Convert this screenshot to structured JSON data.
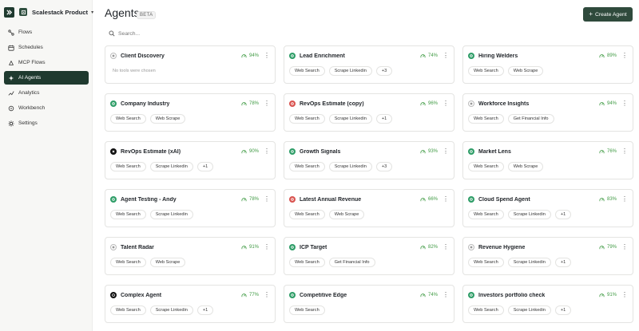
{
  "workspace": {
    "name": "Scalestack Product"
  },
  "nav": [
    {
      "label": "Flows",
      "icon": "flows-icon"
    },
    {
      "label": "Schedules",
      "icon": "calendar-icon"
    },
    {
      "label": "MCP Flows",
      "icon": "mcp-icon"
    },
    {
      "label": "AI Agents",
      "icon": "sparkle-icon",
      "active": true
    },
    {
      "label": "Analytics",
      "icon": "chart-icon"
    },
    {
      "label": "Workbench",
      "icon": "workbench-icon"
    },
    {
      "label": "Settings",
      "icon": "gear-icon"
    }
  ],
  "header": {
    "title": "Agents",
    "badge": "BETA",
    "create_label": "Create Agent"
  },
  "search": {
    "placeholder": "Search..."
  },
  "colors": {
    "brand": "#1f3a2f",
    "score_green": "#3f9a43",
    "icon_green": "#2e9d67",
    "icon_red": "#d9534f"
  },
  "no_tools_text": "No tools were chosen",
  "agents": [
    {
      "name": "Client Discovery",
      "icon": "plus-circle-icon",
      "score": "94%",
      "tools": []
    },
    {
      "name": "Lead Enrichment",
      "icon": "green-circle-icon",
      "score": "74%",
      "tools": [
        "Web Search",
        "Scrape Linkedin",
        "+3"
      ]
    },
    {
      "name": "Hiring Welders",
      "icon": "green-circle-icon",
      "score": "89%",
      "tools": [
        "Web Search",
        "Web Scrape"
      ]
    },
    {
      "name": "Company Industry",
      "icon": "green-circle-icon",
      "score": "78%",
      "tools": [
        "Web Search",
        "Web Scrape"
      ]
    },
    {
      "name": "RevOps Estimate (copy)",
      "icon": "red-circle-icon",
      "score": "96%",
      "tools": [
        "Web Search",
        "Scrape Linkedin",
        "+1"
      ]
    },
    {
      "name": "Workforce Insights",
      "icon": "plus-circle-icon",
      "score": "94%",
      "tools": [
        "Web Search",
        "Get Financial Info"
      ]
    },
    {
      "name": "RevOps Estimate (xAI)",
      "icon": "xai-icon",
      "score": "90%",
      "tools": [
        "Web Search",
        "Scrape Linkedin",
        "+1"
      ]
    },
    {
      "name": "Growth Signals",
      "icon": "green-circle-icon",
      "score": "93%",
      "tools": [
        "Web Search",
        "Scrape Linkedin",
        "+3"
      ]
    },
    {
      "name": "Market Lens",
      "icon": "green-circle-icon",
      "score": "76%",
      "tools": [
        "Web Search",
        "Web Scrape"
      ]
    },
    {
      "name": "Agent Testing - Andy",
      "icon": "green-circle-icon",
      "score": "78%",
      "tools": [
        "Web Search",
        "Scrape Linkedin"
      ]
    },
    {
      "name": "Latest Annual Revenue",
      "icon": "red-circle-icon",
      "score": "66%",
      "tools": [
        "Web Search",
        "Web Scrape"
      ]
    },
    {
      "name": "Cloud Spend Agent",
      "icon": "green-circle-icon",
      "score": "83%",
      "tools": [
        "Web Search",
        "Scrape Linkedin",
        "+1"
      ]
    },
    {
      "name": "Talent Radar",
      "icon": "plus-circle-icon",
      "score": "91%",
      "tools": [
        "Web Search",
        "Web Scrape"
      ]
    },
    {
      "name": "ICP Target",
      "icon": "green-circle-icon",
      "score": "82%",
      "tools": [
        "Web Search",
        "Get Financial Info"
      ]
    },
    {
      "name": "Revenue Hygiene",
      "icon": "plus-circle-icon",
      "score": "79%",
      "tools": [
        "Web Search",
        "Scrape Linkedin",
        "+1"
      ]
    },
    {
      "name": "Complex Agent",
      "icon": "openai-icon",
      "score": "77%",
      "tools": [
        "Web Search",
        "Scrape Linkedin",
        "+1"
      ]
    },
    {
      "name": "Competitive Edge",
      "icon": "green-circle-icon",
      "score": "74%",
      "tools": [
        "Web Search"
      ]
    },
    {
      "name": "Investors portfolio check",
      "icon": "green-circle-icon",
      "score": "91%",
      "tools": [
        "Web Search",
        "Scrape Linkedin",
        "+1"
      ]
    }
  ]
}
